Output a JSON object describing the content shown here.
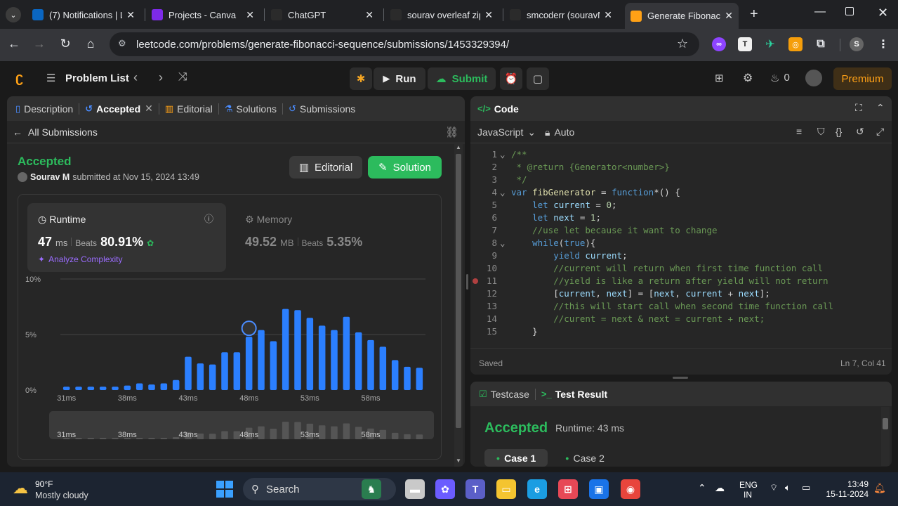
{
  "browser": {
    "tabs": [
      {
        "title": "(7) Notifications | L",
        "icon": "linkedin-icon",
        "color": "#0a66c2"
      },
      {
        "title": "Projects - Canva",
        "icon": "canva-icon",
        "color": "#7d2ae8"
      },
      {
        "title": "ChatGPT",
        "icon": "chatgpt-icon",
        "color": "#2b2b2b"
      },
      {
        "title": "sourav overleaf zip",
        "icon": "overleaf-icon",
        "color": "#2b2b2b"
      },
      {
        "title": "smcoderr (souravM",
        "icon": "github-icon",
        "color": "#2b2b2b"
      },
      {
        "title": "Generate Fibonacc",
        "icon": "leetcode-icon",
        "color": "#ffa116"
      }
    ],
    "url": "leetcode.com/problems/generate-fibonacci-sequence/submissions/1453329394/"
  },
  "nav": {
    "problem_list": "Problem List",
    "run": "Run",
    "submit": "Submit",
    "coins": "0",
    "premium": "Premium"
  },
  "left": {
    "tabs": [
      "Description",
      "Accepted",
      "Editorial",
      "Solutions",
      "Submissions"
    ],
    "all_submissions": "All Submissions",
    "status": "Accepted",
    "user": "Sourav M",
    "submitted": "submitted at Nov 15, 2024 13:49",
    "editorial_btn": "Editorial",
    "solution_btn": "Solution",
    "runtime_label": "Runtime",
    "runtime_value": "47",
    "runtime_unit": "ms",
    "beats_label": "Beats",
    "runtime_beats": "80.91%",
    "analyze": "Analyze Complexity",
    "memory_label": "Memory",
    "memory_value": "49.52",
    "memory_unit": "MB",
    "memory_beats": "5.35%"
  },
  "chart_data": {
    "type": "bar",
    "y_ticks": [
      "10%",
      "5%",
      "0%"
    ],
    "ylim": [
      0,
      10
    ],
    "x_tick_labels": [
      "31ms",
      "38ms",
      "43ms",
      "48ms",
      "53ms",
      "58ms"
    ],
    "values": [
      0.3,
      0.3,
      0.3,
      0.3,
      0.3,
      0.4,
      0.6,
      0.5,
      0.6,
      0.9,
      3.0,
      2.4,
      2.3,
      3.4,
      3.4,
      4.8,
      5.4,
      4.4,
      7.3,
      7.2,
      6.5,
      5.8,
      5.4,
      6.6,
      5.2,
      4.5,
      3.9,
      2.7,
      2.1,
      2.0
    ],
    "highlight_index": 15,
    "minimap_labels": [
      "31ms",
      "38ms",
      "43ms",
      "48ms",
      "53ms",
      "58ms"
    ]
  },
  "code": {
    "title": "Code",
    "language": "JavaScript",
    "mode": "Auto",
    "status": "Saved",
    "cursor": "Ln 7, Col 41",
    "lines": [
      {
        "n": "1",
        "t": "/**"
      },
      {
        "n": "2",
        "t": " * @return {Generator<number>}"
      },
      {
        "n": "3",
        "t": " */"
      },
      {
        "n": "4",
        "t": "var fibGenerator = function*() {"
      },
      {
        "n": "5",
        "t": "    let current = 0;"
      },
      {
        "n": "6",
        "t": "    let next = 1;"
      },
      {
        "n": "7",
        "t": "    //use let because it want to change"
      },
      {
        "n": "8",
        "t": "    while(true){"
      },
      {
        "n": "9",
        "t": "        yield current;"
      },
      {
        "n": "10",
        "t": "        //current will return when first time function call"
      },
      {
        "n": "11",
        "t": "        //yield is like a return after yield will not return"
      },
      {
        "n": "12",
        "t": "        [current, next] = [next, current + next];"
      },
      {
        "n": "13",
        "t": "        //this will start call when second time function call"
      },
      {
        "n": "14",
        "t": "        //curent = next & next = current + next;"
      },
      {
        "n": "15",
        "t": "    }"
      }
    ]
  },
  "test": {
    "testcase_tab": "Testcase",
    "result_tab": "Test Result",
    "status": "Accepted",
    "runtime": "Runtime: 43 ms",
    "cases": [
      "Case 1",
      "Case 2"
    ]
  },
  "taskbar": {
    "weather_temp": "90°F",
    "weather_desc": "Mostly cloudy",
    "search": "Search",
    "lang1": "ENG",
    "lang2": "IN",
    "time": "13:49",
    "date": "15-11-2024"
  }
}
